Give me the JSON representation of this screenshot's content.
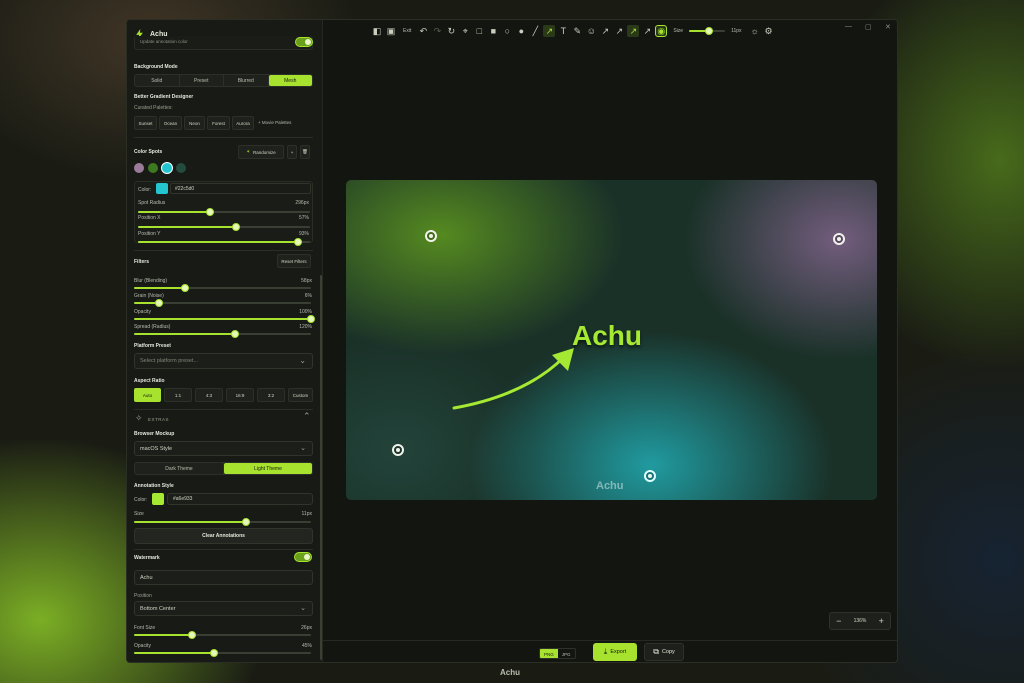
{
  "app": {
    "title": "Achu",
    "bottom_caption": "Achu"
  },
  "sidebar": {
    "cut_top_label": "Update annotation color",
    "background_mode": {
      "label": "Background Mode",
      "options": [
        "Solid",
        "Preset",
        "Blurred",
        "Mesh"
      ],
      "selected": "Mesh"
    },
    "gradient": {
      "title": "Better Gradient Designer",
      "palettes_label": "Curated Palettes:",
      "palettes": [
        "Sunset",
        "Ocean",
        "Neon",
        "Forest",
        "Aurora"
      ],
      "more": "+ Movie Palettes"
    },
    "color_spots": {
      "label": "Color Spots",
      "randomize": "Randomize",
      "swatches": [
        "#9a7c9a",
        "#3d7a1f",
        "#22c5d0",
        "#234c3e"
      ],
      "color_label": "Color:",
      "color_value": "#22c5d0",
      "spot_radius": {
        "label": "Spot Radius",
        "value": "296px",
        "fraction": 0.42
      },
      "position_x": {
        "label": "Position X",
        "value": "57%",
        "fraction": 0.57
      },
      "position_y": {
        "label": "Position Y",
        "value": "93%",
        "fraction": 0.93
      }
    },
    "filters": {
      "label": "Filters",
      "reset": "Reset Filters",
      "blur": {
        "label": "Blur (Blending)",
        "value": "58px",
        "fraction": 0.29
      },
      "grain": {
        "label": "Grain (Noise)",
        "value": "6%",
        "fraction": 0.14
      },
      "opacity": {
        "label": "Opacity",
        "value": "100%",
        "fraction": 1.0
      },
      "spread": {
        "label": "Spread (Radius)",
        "value": "120%",
        "fraction": 0.57
      }
    },
    "platform": {
      "label": "Platform Preset",
      "placeholder": "Select platform preset..."
    },
    "aspect": {
      "label": "Aspect Ratio",
      "options": [
        "Auto",
        "1:1",
        "4:3",
        "16:9",
        "3:2",
        "Custom"
      ],
      "selected": "Auto"
    },
    "extras": {
      "label": "EXTRAS"
    },
    "browser": {
      "label": "Browser Mockup",
      "value": "macOS Style",
      "themes": [
        "Dark Theme",
        "Light Theme"
      ],
      "selected": "Light Theme"
    },
    "annotation": {
      "label": "Annotation Style",
      "color_label": "Color:",
      "color_value": "#a6e933",
      "size_label": "Size",
      "size_value": "11px",
      "size_fraction": 0.63,
      "clear": "Clear Annotations"
    },
    "watermark": {
      "label": "Watermark",
      "text": "Achu",
      "position_label": "Position",
      "position_value": "Bottom Center",
      "font_label": "Font Size",
      "font_value": "26px",
      "font_fraction": 0.33,
      "opacity_label": "Opacity",
      "opacity_value": "45%",
      "opacity_fraction": 0.45
    }
  },
  "toolbar": {
    "exit": "Exit",
    "size_label": "Size",
    "size_value": "11px",
    "size_fraction": 0.55
  },
  "canvas": {
    "headline": "Achu",
    "watermark": "Achu"
  },
  "zoom": {
    "value": "136%"
  },
  "footer": {
    "formats": [
      "PNG",
      "JPG"
    ],
    "selected": "PNG",
    "export": "Export",
    "copy": "Copy"
  },
  "colors": {
    "accent": "#a6e22e",
    "panel": "#181a15",
    "window": "#131510"
  }
}
